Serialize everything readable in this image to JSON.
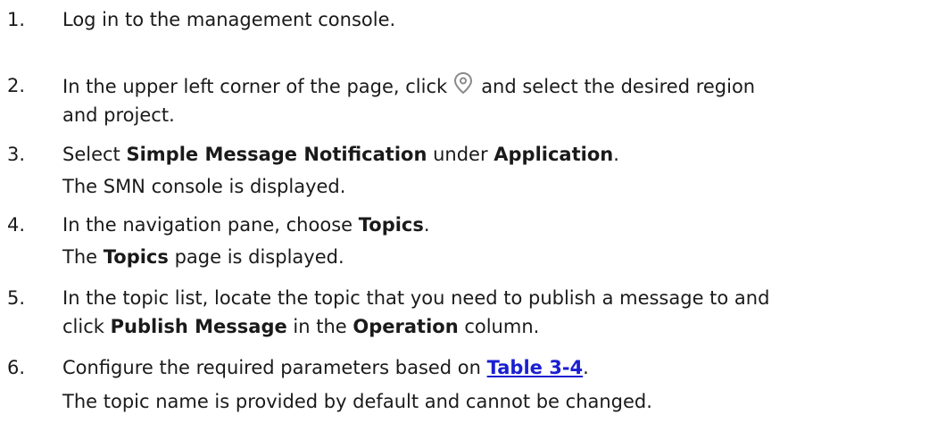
{
  "steps": [
    {
      "num": "1.",
      "text": "Log in to the management console."
    },
    {
      "num": "2.",
      "pre": "In the upper left corner of the page, click",
      "icon": "location-pin-icon",
      "post_line1": "and select the desired region",
      "post_line2": "and project."
    },
    {
      "num": "3.",
      "pre": "Select ",
      "bold1": "Simple Message Notification",
      "mid": " under ",
      "bold2": "Application",
      "end": ".",
      "sub": "The SMN console is displayed."
    },
    {
      "num": "4.",
      "pre": "In the navigation pane, choose ",
      "bold1": "Topics",
      "end": ".",
      "sub_pre": "The ",
      "sub_bold": "Topics",
      "sub_post": " page is displayed."
    },
    {
      "num": "5.",
      "line1": "In the topic list, locate the topic that you need to publish a message to and",
      "line2_pre": "click ",
      "bold1": "Publish Message",
      "mid": " in the ",
      "bold2": "Operation",
      "end": " column."
    },
    {
      "num": "6.",
      "pre": "Configure the required parameters based on ",
      "link": "Table 3-4",
      "end": ".",
      "sub": "The topic name is provided by default and cannot be changed."
    }
  ],
  "colors": {
    "text": "#1a1a1a",
    "link": "#1a1fd0",
    "icon": "#8a8a8a"
  }
}
